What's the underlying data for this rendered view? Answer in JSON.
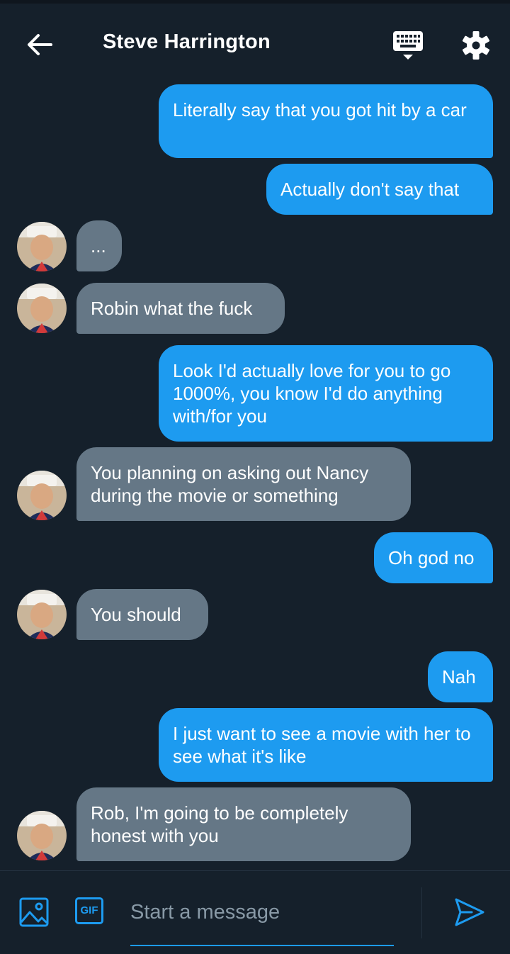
{
  "header": {
    "title": "Steve Harrington",
    "icons": [
      "back-arrow-icon",
      "keyboard-icon",
      "settings-gear-icon"
    ]
  },
  "messages": [
    {
      "side": "out",
      "text": "Literally say that you got hit by a car"
    },
    {
      "side": "out",
      "text": "Actually don't say that"
    },
    {
      "side": "in",
      "text": "..."
    },
    {
      "side": "in",
      "text": "Robin what the fuck"
    },
    {
      "side": "out",
      "text": "Look I'd actually love for you to go 1000%, you know I'd do anything with/for you"
    },
    {
      "side": "in",
      "text": "You planning on asking out Nancy during the movie or something"
    },
    {
      "side": "out",
      "text": "Oh god no"
    },
    {
      "side": "in",
      "text": "You should"
    },
    {
      "side": "out",
      "text": "Nah"
    },
    {
      "side": "out",
      "text": "I just want to see a movie with her to see what it's like"
    },
    {
      "side": "in",
      "text": "Rob, I'm going to be completely honest with you"
    }
  ],
  "composer": {
    "gif_label": "GIF",
    "placeholder": "Start a message",
    "icons": [
      "image-icon",
      "gif-icon",
      "send-icon"
    ]
  },
  "colors": {
    "background": "#15202b",
    "outgoing_bubble": "#1d9bf0",
    "incoming_bubble": "#657786",
    "accent": "#1d9bf0"
  }
}
